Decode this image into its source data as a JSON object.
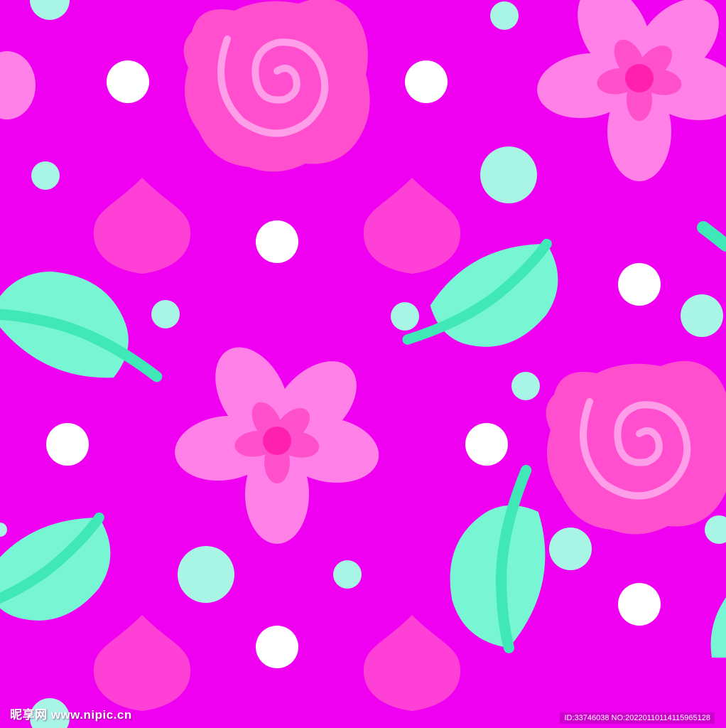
{
  "colors": {
    "background": "#f000f0",
    "rose": "#ff4fcf",
    "rose_swirl": "#ff9ee8",
    "flower_petal": "#ff80e6",
    "flower_inner": "#ff50cc",
    "flower_center": "#ff20b0",
    "heart": "#ff40d6",
    "leaf": "#78f5d2",
    "leaf_stem": "#40e8b8",
    "dot_white": "#ffffff",
    "dot_mint": "#a8f5e6"
  },
  "icons": [
    "rose-icon",
    "flower-icon",
    "heart-icon",
    "leaf-icon",
    "dot-icon"
  ],
  "watermark": {
    "site": "昵享网 www.nipic.cn",
    "id_text": "ID:33746038 NO:20220110114115965128"
  }
}
